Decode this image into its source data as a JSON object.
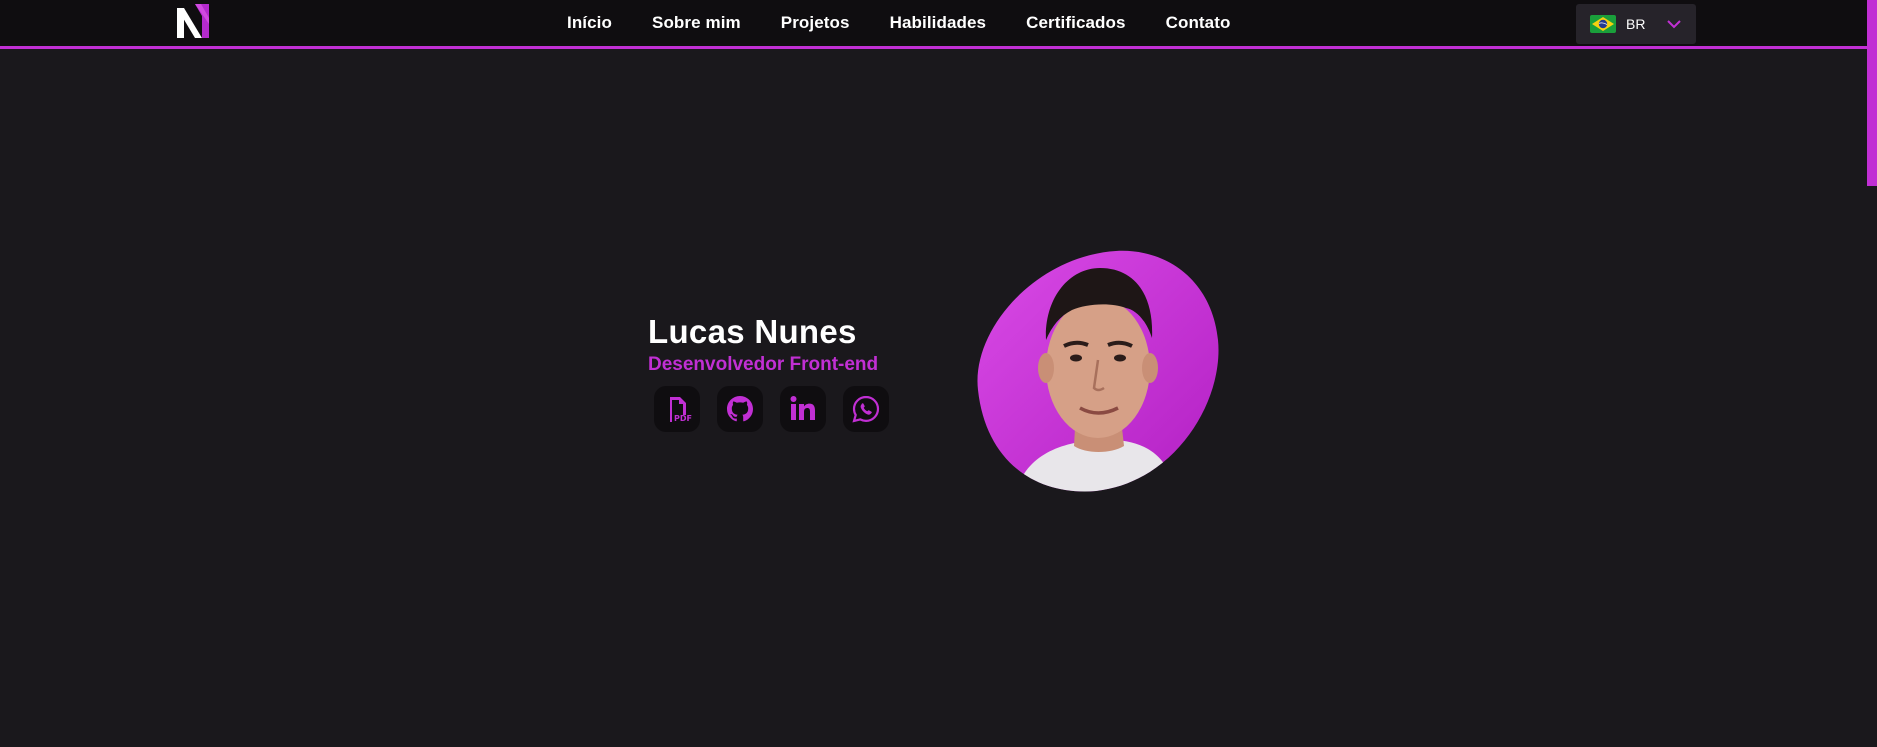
{
  "brand": {
    "logo_icon": "n-monogram-logo"
  },
  "nav": {
    "items": [
      {
        "label": "Início"
      },
      {
        "label": "Sobre mim"
      },
      {
        "label": "Projetos"
      },
      {
        "label": "Habilidades"
      },
      {
        "label": "Certificados"
      },
      {
        "label": "Contato"
      }
    ]
  },
  "language": {
    "code": "BR",
    "flag_icon": "brazil-flag-icon"
  },
  "hero": {
    "name": "Lucas Nunes",
    "role": "Desenvolvedor Front-end",
    "socials": [
      {
        "icon": "pdf-icon",
        "badge": "PDF"
      },
      {
        "icon": "github-icon"
      },
      {
        "icon": "linkedin-icon"
      },
      {
        "icon": "whatsapp-icon"
      }
    ],
    "photo": "profile-photo"
  },
  "colors": {
    "accent": "#c12fd4",
    "background": "#1a181c",
    "navbar": "#0f0d10"
  }
}
